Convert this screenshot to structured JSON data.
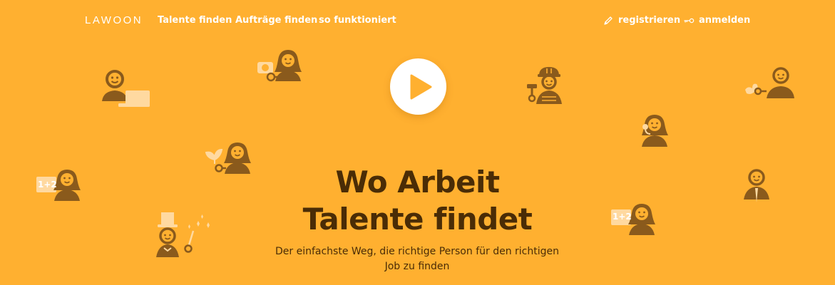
{
  "nav": {
    "logo": "LAWOON",
    "links": [
      "Talente finden",
      "Aufträge finden",
      "so funktioniert"
    ],
    "register_label": "registrieren",
    "login_label": "anmelden"
  },
  "hero": {
    "title_line1": "Wo Arbeit",
    "title_line2": "Talente findet",
    "subtitle": "Der einfachste Weg, die richtige Person für den richtigen Job zu finden",
    "play_icon": "play-icon"
  },
  "decorations": {
    "tutor_badge": "1+2"
  },
  "colors": {
    "background": "#FFB030",
    "text_dark": "#4A2C06",
    "figure": "#8A5A1C",
    "figure_light": "#FFD9A0"
  }
}
